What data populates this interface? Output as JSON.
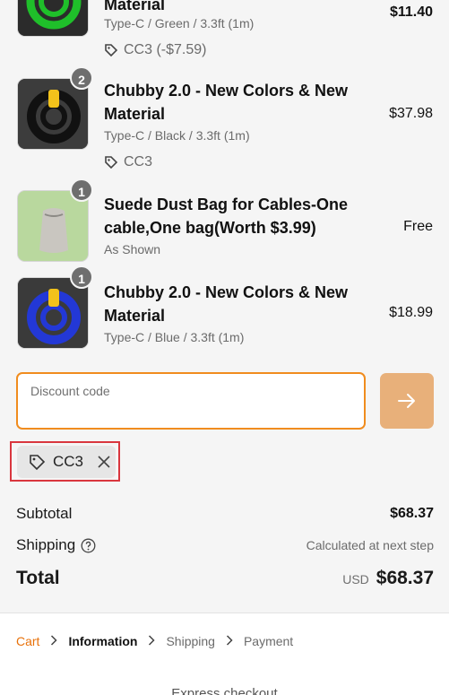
{
  "items": [
    {
      "title": "Material",
      "variant": "Type-C / Green / 3.3ft (1m)",
      "discount": "CC3 (-$7.59)",
      "price": "$11.40",
      "thumb_color": "#1fbf2a"
    },
    {
      "quantity": "2",
      "title": "Chubby 2.0 - New Colors & New Material",
      "variant": "Type-C / Black / 3.3ft (1m)",
      "discount": "CC3",
      "price": "$37.98",
      "thumb_color": "#1d1d1d"
    },
    {
      "quantity": "1",
      "title": "Suede Dust Bag for Cables-One cable,One bag(Worth $3.99)",
      "variant": "As Shown",
      "price": "Free",
      "thumb_color": "#b5d49a"
    },
    {
      "quantity": "1",
      "title": "Chubby 2.0 - New Colors & New Material",
      "variant": "Type-C / Blue / 3.3ft (1m)",
      "price": "$18.99",
      "thumb_color": "#2338d6"
    }
  ],
  "discount": {
    "placeholder": "Discount code",
    "applied_code": "CC3"
  },
  "totals": {
    "subtotal_label": "Subtotal",
    "subtotal_value": "$68.37",
    "shipping_label": "Shipping",
    "shipping_value": "Calculated at next step",
    "total_label": "Total",
    "currency": "USD",
    "total_value": "$68.37"
  },
  "breadcrumb": {
    "cart": "Cart",
    "information": "Information",
    "shipping": "Shipping",
    "payment": "Payment"
  },
  "express_label": "Express checkout",
  "colors": {
    "accent": "#f08c1e",
    "apply_button": "#e8b07a",
    "highlight_box": "#d9363e"
  }
}
